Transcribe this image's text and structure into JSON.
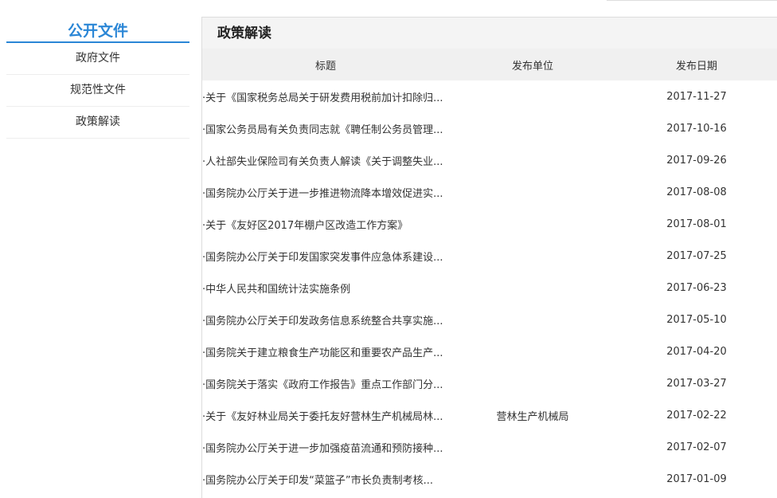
{
  "sidebar": {
    "title": "公开文件",
    "items": [
      {
        "label": "政府文件"
      },
      {
        "label": "规范性文件"
      },
      {
        "label": "政策解读"
      }
    ]
  },
  "main": {
    "title": "政策解读",
    "columns": {
      "title": "标题",
      "unit": "发布单位",
      "date": "发布日期"
    },
    "rows": [
      {
        "title": "·关于《国家税务总局关于研发费用税前加计扣除归...",
        "unit": "",
        "date": "2017-11-27"
      },
      {
        "title": "·国家公务员局有关负责同志就《聘任制公务员管理...",
        "unit": "",
        "date": "2017-10-16"
      },
      {
        "title": "·人社部失业保险司有关负责人解读《关于调整失业...",
        "unit": "",
        "date": "2017-09-26"
      },
      {
        "title": "·国务院办公厅关于进一步推进物流降本增效促进实...",
        "unit": "",
        "date": "2017-08-08"
      },
      {
        "title": "·关于《友好区2017年棚户区改造工作方案》",
        "unit": "",
        "date": "2017-08-01"
      },
      {
        "title": "·国务院办公厅关于印发国家突发事件应急体系建设...",
        "unit": "",
        "date": "2017-07-25"
      },
      {
        "title": "·中华人民共和国统计法实施条例",
        "unit": "",
        "date": "2017-06-23"
      },
      {
        "title": "·国务院办公厅关于印发政务信息系统整合共享实施...",
        "unit": "",
        "date": "2017-05-10"
      },
      {
        "title": "·国务院关于建立粮食生产功能区和重要农产品生产...",
        "unit": "",
        "date": "2017-04-20"
      },
      {
        "title": "·国务院关于落实《政府工作报告》重点工作部门分...",
        "unit": "",
        "date": "2017-03-27"
      },
      {
        "title": "·关于《友好林业局关于委托友好营林生产机械局林...",
        "unit": "营林生产机械局",
        "date": "2017-02-22"
      },
      {
        "title": "·国务院办公厅关于进一步加强疫苗流通和预防接种...",
        "unit": "",
        "date": "2017-02-07"
      },
      {
        "title": "·国务院办公厅关于印发“菜篮子”市长负责制考核...",
        "unit": "",
        "date": "2017-01-09"
      }
    ]
  },
  "colors": {
    "accent": "#2a86d6",
    "header_bg": "#f0f0f0"
  }
}
